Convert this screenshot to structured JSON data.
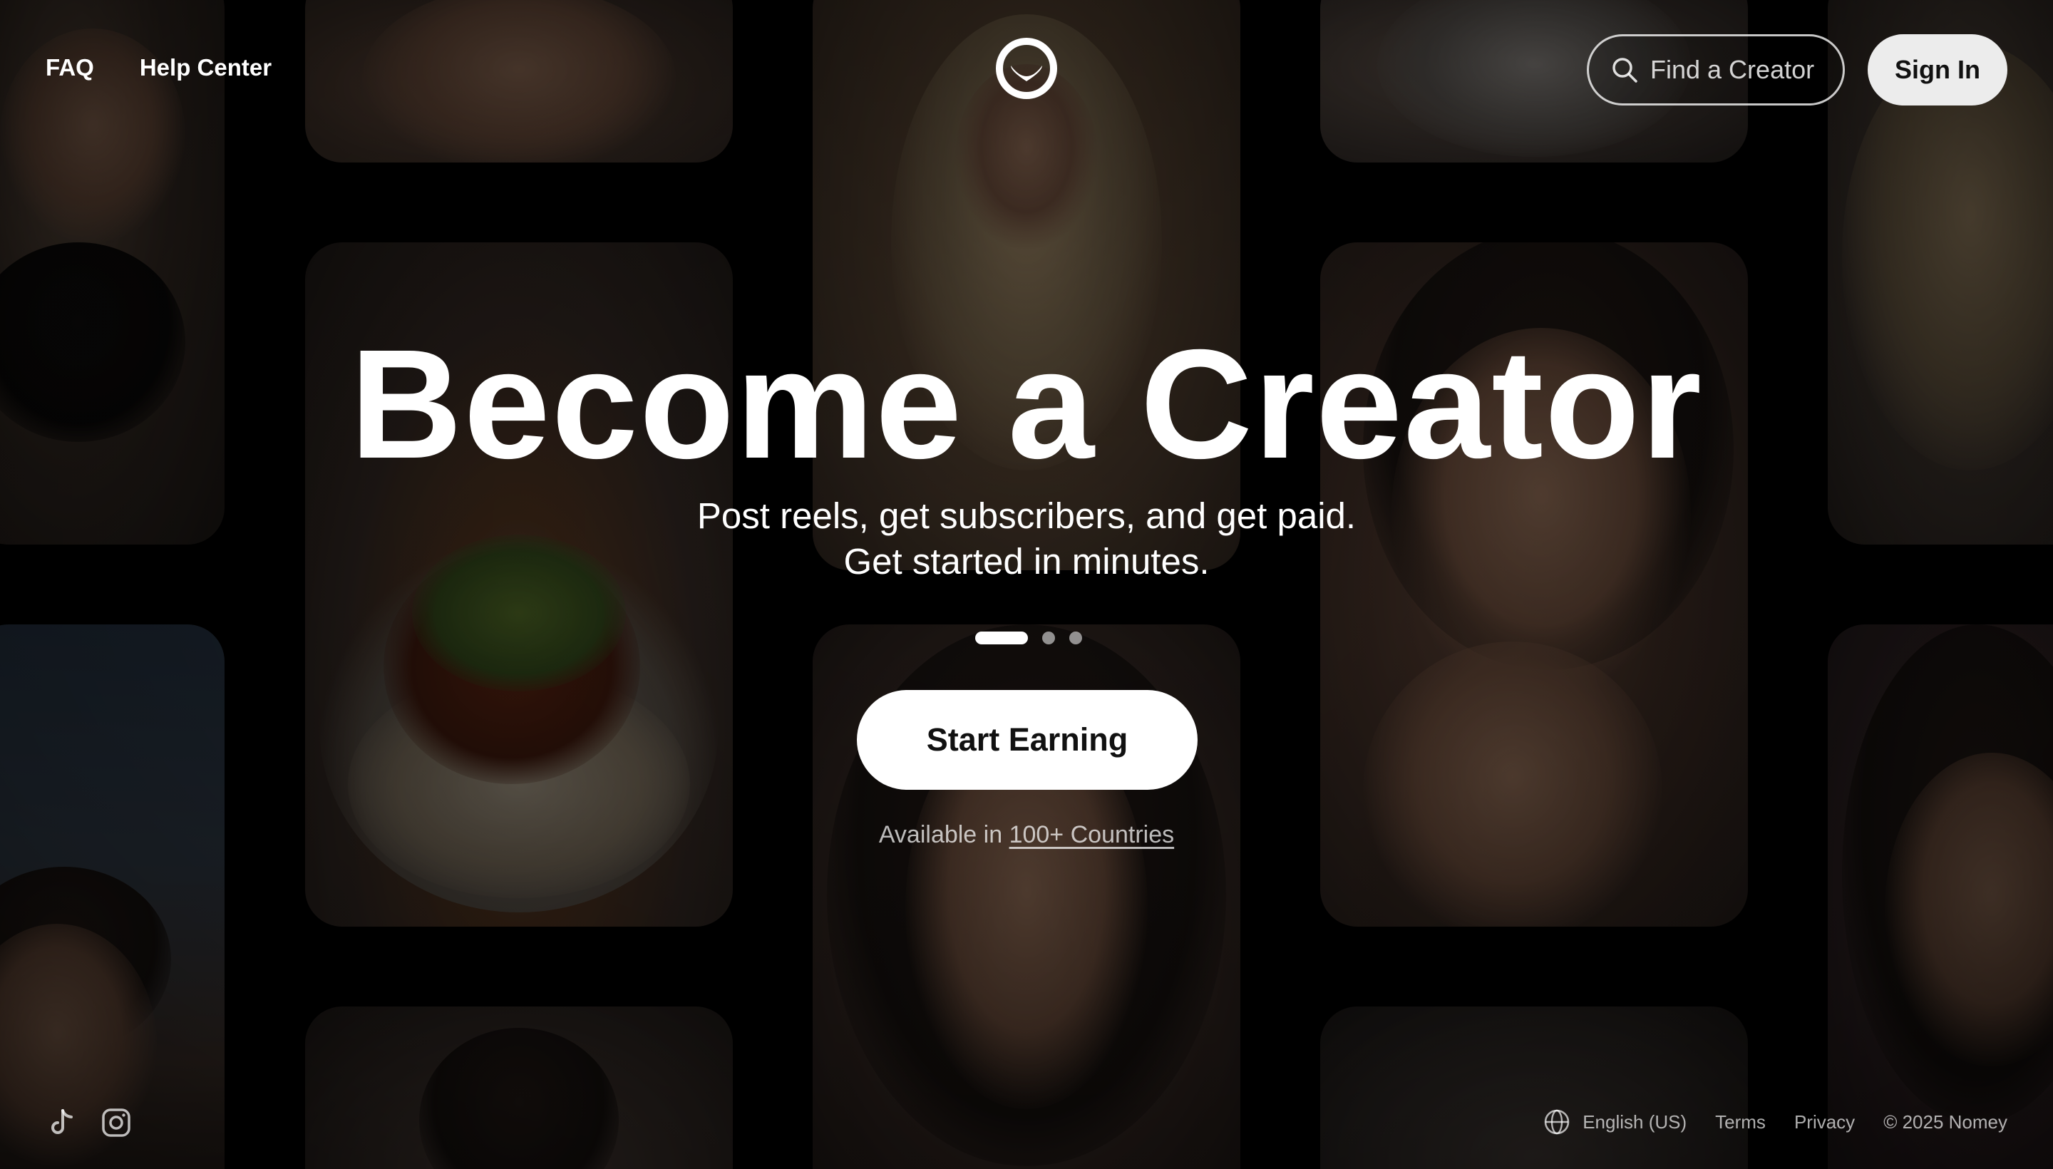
{
  "nav": {
    "faq": "FAQ",
    "help_center": "Help Center"
  },
  "logo_icon": "smile-face-icon",
  "header": {
    "search_label": "Find a Creator",
    "sign_in": "Sign In"
  },
  "hero": {
    "title": "Become a Creator",
    "subtitle_line1": "Post reels, get subscribers, and get paid.",
    "subtitle_line2": "Get started in minutes.",
    "carousel_active_index": 0,
    "carousel_count": 3,
    "cta": "Start Earning",
    "availability_prefix": "Available in ",
    "availability_link": "100+ Countries"
  },
  "footer": {
    "social_icons": [
      "tiktok-icon",
      "instagram-icon"
    ],
    "language": "English (US)",
    "terms": "Terms",
    "privacy": "Privacy",
    "copyright": "© 2025 Nomey"
  },
  "colors": {
    "background": "#000000",
    "primary_button": "#ffffff",
    "sign_in_button": "#ececec",
    "text": "#ffffff"
  }
}
